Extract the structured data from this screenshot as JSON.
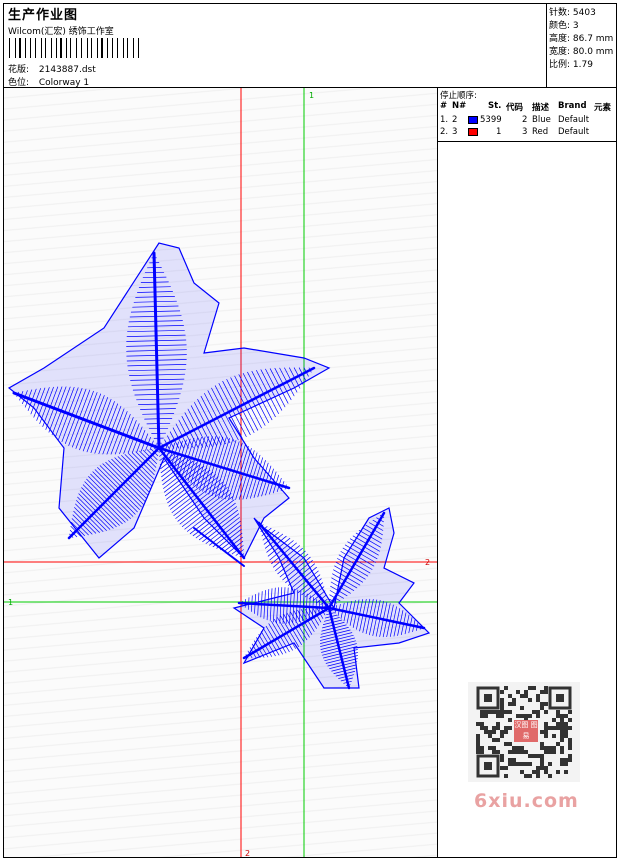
{
  "header": {
    "title": "生产作业图",
    "subtitle": "Wilcom(汇宏) 绣饰工作室",
    "design_label": "花版:",
    "design_value": "2143887.dst",
    "colorway_label": "色位:",
    "colorway_value": "Colorway 1"
  },
  "stats": {
    "stitches": "针数: 5403",
    "colors": "颜色: 3",
    "height": "高度: 86.7 mm",
    "width": "宽度: 80.0 mm",
    "ratio": "比例: 1.79"
  },
  "stop_sequence": {
    "title": "停止顺序:",
    "columns": [
      "#",
      "N#",
      "St.",
      "代码",
      "描述",
      "Brand",
      "元素"
    ],
    "rows": [
      {
        "num": "1.",
        "n": "2",
        "color": "#0000ff",
        "st": "5399",
        "code": "2",
        "desc": "Blue",
        "brand": "Default"
      },
      {
        "num": "2.",
        "n": "3",
        "color": "#ff0000",
        "st": "1",
        "code": "3",
        "desc": "Red",
        "brand": "Default"
      }
    ]
  },
  "guides": {
    "green_label_top": "1",
    "green_label_left": "1",
    "red_label_right": "2",
    "red_label_bottom": "2"
  },
  "colors": {
    "thread": "#0000ff",
    "guide_red": "#ff0000",
    "guide_green": "#00cc00"
  },
  "watermark": {
    "stamp": "汉图 图易",
    "site": "6xiu.com"
  }
}
